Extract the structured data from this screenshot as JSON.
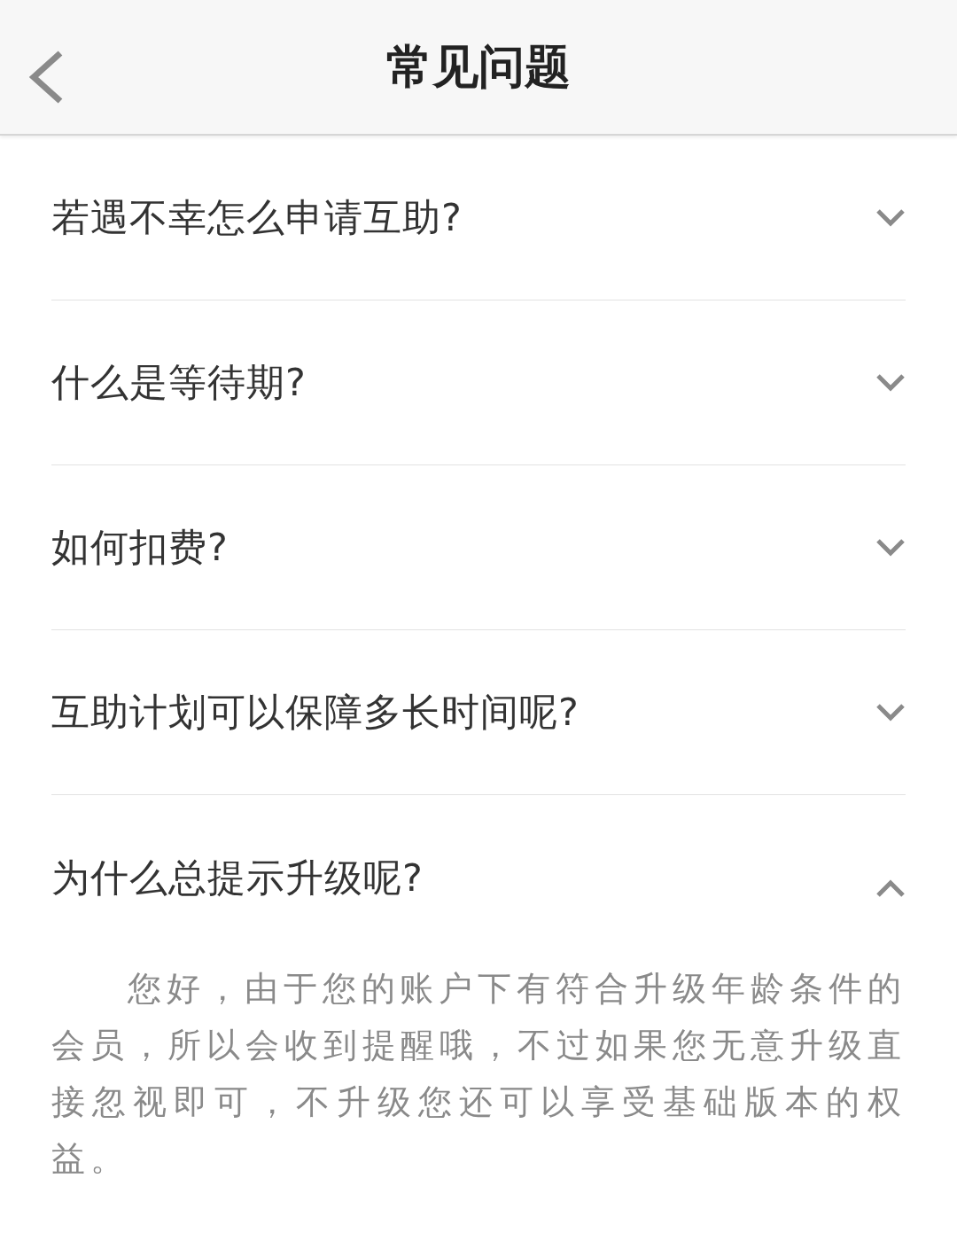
{
  "header": {
    "title": "常见问题"
  },
  "faqs": [
    {
      "question": "若遇不幸怎么申请互助?",
      "expanded": false
    },
    {
      "question": "什么是等待期?",
      "expanded": false
    },
    {
      "question": "如何扣费?",
      "expanded": false
    },
    {
      "question": "互助计划可以保障多长时间呢?",
      "expanded": false
    },
    {
      "question": "为什么总提示升级呢?",
      "expanded": true,
      "answer": "您好，由于您的账户下有符合升级年龄条件的会员，所以会收到提醒哦，不过如果您无意升级直接忽视即可，不升级您还可以享受基础版本的权益。"
    }
  ]
}
